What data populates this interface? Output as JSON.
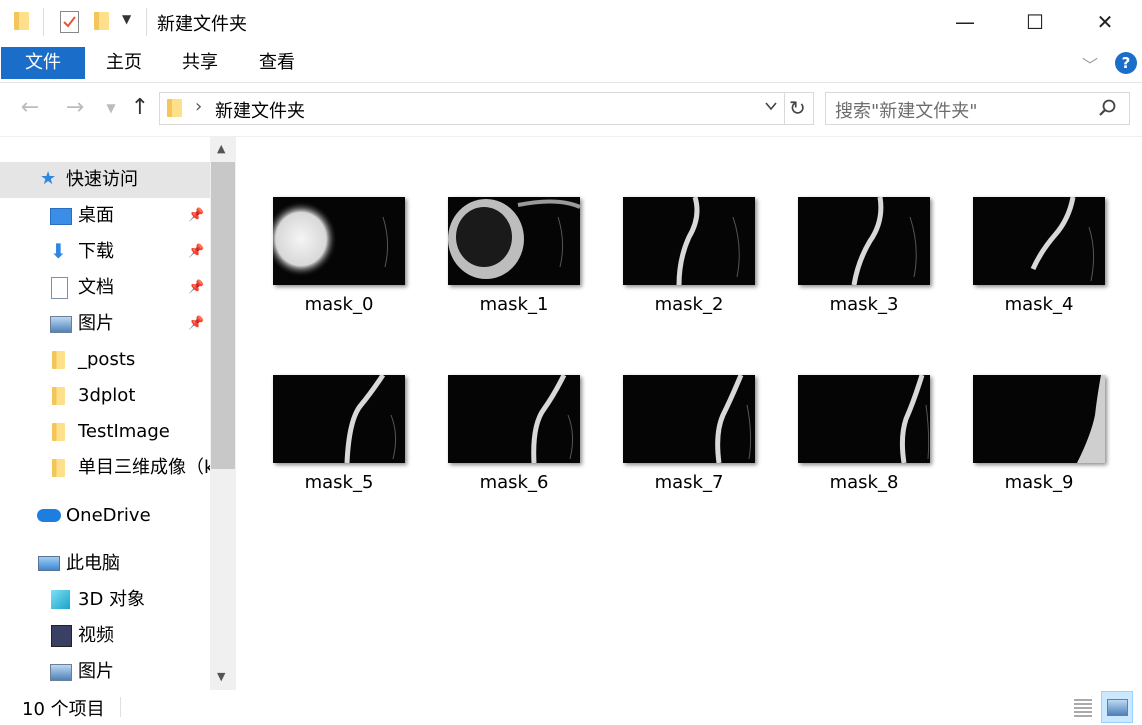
{
  "window": {
    "title": "新建文件夹",
    "controls": {
      "minimize": "—",
      "maximize": "☐",
      "close": "✕"
    }
  },
  "ribbon": {
    "tabs": [
      "文件",
      "主页",
      "共享",
      "查看"
    ],
    "help": "?"
  },
  "address": {
    "separator": "›",
    "path": "新建文件夹",
    "search_placeholder": "搜索\"新建文件夹\""
  },
  "sidebar": {
    "quick_access": "快速访问",
    "pinned": [
      {
        "label": "桌面",
        "icon": "desktop-icon"
      },
      {
        "label": "下载",
        "icon": "download-icon"
      },
      {
        "label": "文档",
        "icon": "document-icon"
      },
      {
        "label": "图片",
        "icon": "picture-icon"
      }
    ],
    "folders": [
      "_posts",
      "3dplot",
      "TestImage",
      "单目三维成像（k"
    ],
    "onedrive": "OneDrive",
    "this_pc": "此电脑",
    "pc_items": [
      {
        "label": "3D 对象",
        "icon": "3d-objects-icon"
      },
      {
        "label": "视频",
        "icon": "video-icon"
      },
      {
        "label": "图片",
        "icon": "picture-icon"
      }
    ]
  },
  "files": [
    {
      "name": "mask_0"
    },
    {
      "name": "mask_1"
    },
    {
      "name": "mask_2"
    },
    {
      "name": "mask_3"
    },
    {
      "name": "mask_4"
    },
    {
      "name": "mask_5"
    },
    {
      "name": "mask_6"
    },
    {
      "name": "mask_7"
    },
    {
      "name": "mask_8"
    },
    {
      "name": "mask_9"
    }
  ],
  "status": {
    "item_count": "10 个项目"
  },
  "colors": {
    "accent": "#1a6dc9",
    "selected_bg": "#cce8ff",
    "hover_bg": "#e5e5e5"
  }
}
